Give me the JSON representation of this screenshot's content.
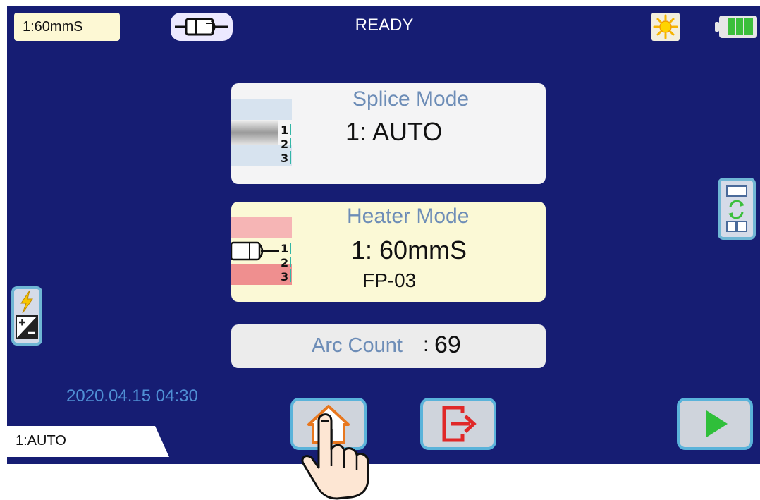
{
  "header": {
    "heater_mode_short": "1:60mmS",
    "status": "READY",
    "icons": [
      "fiber-holder-icon",
      "brightness-icon",
      "battery-icon"
    ]
  },
  "splice_mode": {
    "title": "Splice Mode",
    "value": "1: AUTO",
    "icon_digits": [
      "1",
      "2",
      "3"
    ]
  },
  "heater_mode": {
    "title": "Heater Mode",
    "value": "1: 60mmS",
    "sleeve": "FP-03",
    "icon_digits": [
      "1",
      "2",
      "3"
    ]
  },
  "arc_count": {
    "label": "Arc Count",
    "separator": ":",
    "value": "69"
  },
  "footer": {
    "datetime": "2020.04.15 04:30",
    "splice_mode_short": "1:AUTO",
    "buttons": [
      "home-icon",
      "exit-icon",
      "start-icon"
    ]
  },
  "colors": {
    "screen_bg": "#161d73",
    "card_title": "#6d8db7",
    "button_border": "#5ab3da",
    "accent_green": "#3bbf3b",
    "accent_red": "#e02828"
  }
}
